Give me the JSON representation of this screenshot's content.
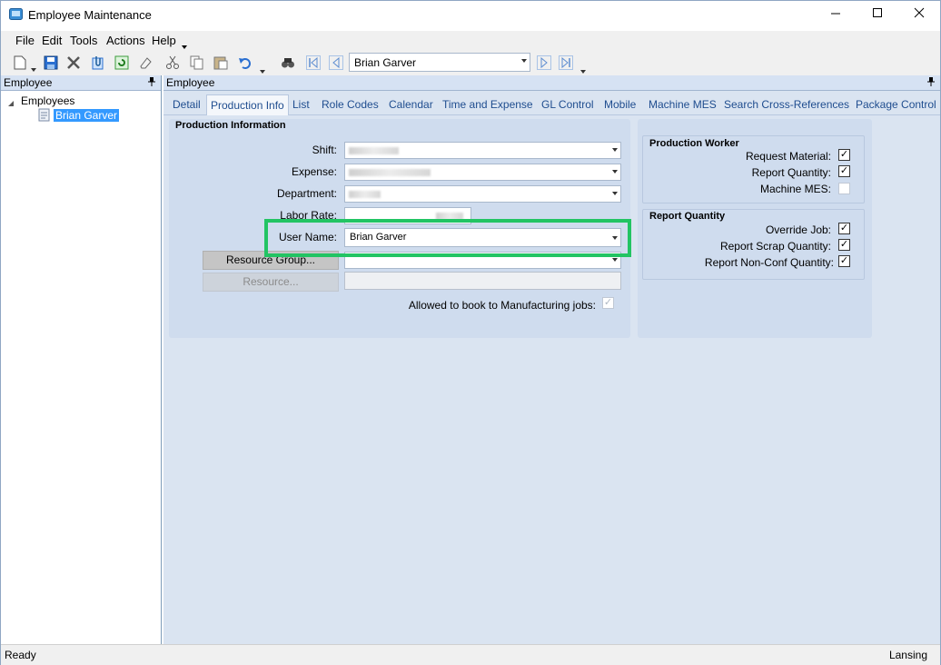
{
  "window": {
    "title": "Employee Maintenance",
    "icon": "app-icon",
    "controls": [
      "minimize",
      "maximize",
      "close"
    ]
  },
  "menu": [
    "File",
    "Edit",
    "Tools",
    "Actions",
    "Help"
  ],
  "toolbar": {
    "icons": [
      "new-icon",
      "save-icon",
      "delete-icon",
      "attach-icon",
      "refresh-icon",
      "clear-icon",
      "cut-icon",
      "copy-icon",
      "paste-icon",
      "undo-icon",
      "search-icon",
      "first-record-icon",
      "previous-record-icon",
      "next-record-icon",
      "last-record-icon"
    ],
    "record_combo": "Brian Garver"
  },
  "left_panel": {
    "header": "Employee",
    "tree_root": "Employees",
    "tree_child": "Brian Garver"
  },
  "main_panel": {
    "header": "Employee",
    "tabs": [
      "Detail",
      "Production Info",
      "List",
      "Role Codes",
      "Calendar",
      "Time and Expense",
      "GL Control",
      "Mobile",
      "Machine MES",
      "Search Cross-References",
      "Package Control"
    ],
    "active_tab": "Production Info"
  },
  "production_info": {
    "title": "Production Information",
    "shift_label": "Shift:",
    "expense_label": "Expense:",
    "department_label": "Department:",
    "labor_rate_label": "Labor Rate:",
    "user_name_label": "User Name:",
    "user_name_value": "Brian Garver",
    "resource_group_button": "Resource Group...",
    "resource_button": "Resource...",
    "allowed_label": "Allowed to book to Manufacturing jobs:",
    "allowed_checked": true
  },
  "production_worker": {
    "title": "Production Worker",
    "request_material_label": "Request Material:",
    "request_material_checked": true,
    "report_quantity_label": "Report Quantity:",
    "report_quantity_checked": true,
    "machine_mes_label": "Machine MES:",
    "machine_mes_checked": false
  },
  "report_quantity": {
    "title": "Report Quantity",
    "override_job_label": "Override Job:",
    "override_job_checked": true,
    "report_scrap_label": "Report Scrap Quantity:",
    "report_scrap_checked": true,
    "report_nonconf_label": "Report Non-Conf Quantity:",
    "report_nonconf_checked": true
  },
  "status": {
    "left": "Ready",
    "right": "Lansing"
  },
  "colors": {
    "highlight": "#22c463",
    "panel_bg": "#dae4f1",
    "group_bg": "#cfdcee",
    "tab_text": "#1f4d8f"
  }
}
